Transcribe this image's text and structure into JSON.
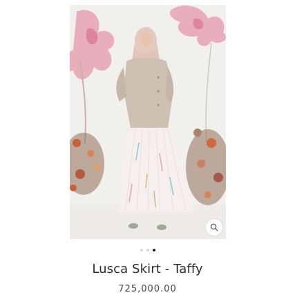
{
  "product": {
    "title": "Lusca Skirt - Taffy",
    "price": "725,000.00",
    "image_alt": "Model wearing beige top and pastel pleated skirt"
  },
  "gallery": {
    "dot_count": 3,
    "active_index": 2
  },
  "icons": {
    "zoom": "magnifier-icon"
  },
  "colors": {
    "text": "#2b2b2b",
    "price_text": "#444444",
    "dot_inactive": "#d8d8d8",
    "dot_active": "#222222",
    "image_background": "#f1efec"
  }
}
